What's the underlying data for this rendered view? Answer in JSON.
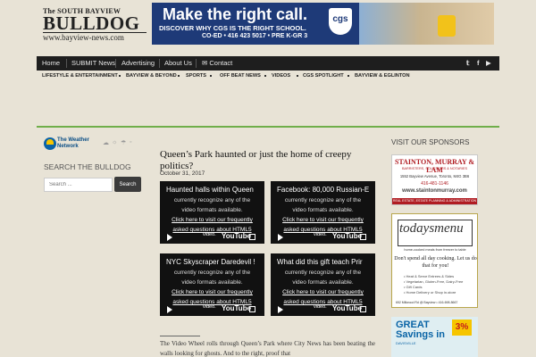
{
  "masthead": {
    "line1": "The SOUTH BAYVIEW",
    "line2": "BULLDOG",
    "line3": "www.bayview-news.com"
  },
  "banner": {
    "headline": "Make the right call.",
    "line1": "DISCOVER WHY CGS IS THE RIGHT SCHOOL.",
    "line2": "CO-ED • 416 423 5017 • PRE K-GR 3",
    "logo": "cgs"
  },
  "nav": {
    "items": [
      "Home",
      "SUBMIT News",
      "Advertising",
      "About Us",
      "Contact"
    ],
    "social_icons": [
      "twitter-icon",
      "facebook-icon",
      "youtube-icon"
    ]
  },
  "subnav": {
    "items": [
      "LIFESTYLE & ENTERTAINMENT",
      "BAYVIEW & BEYOND",
      "SPORTS",
      "OFF BEAT NEWS",
      "VIDEOS",
      "CGS SPOTLIGHT",
      "BAYVIEW & EGLINTON"
    ]
  },
  "sidebar": {
    "weather": {
      "line1": "The Weather",
      "line2": "Network"
    },
    "search_heading": "SEARCH THE BULLDOG",
    "search_placeholder": "Search ...",
    "search_button": "Search"
  },
  "article": {
    "title": "Queen’s Park haunted or just the home of creepy politics?",
    "date": "October 31, 2017",
    "body": "The Video Wheel rolls through Queen’s Park where City News has been beating the walls looking for ghosts. And to the right, proof that"
  },
  "videos": [
    {
      "title": "Haunted halls within Queen"
    },
    {
      "title": "Facebook: 80,000 Russian-E"
    },
    {
      "title": "NYC Skyscraper Daredevil !"
    },
    {
      "title": "What did this gift teach Prir"
    }
  ],
  "video_player": {
    "message1": "currently recognize any of the",
    "message2": "video formats available.",
    "link1": "Click here to visit our frequently",
    "link2": "asked questions about HTML5",
    "link3": "video.",
    "youtube": "YouTube"
  },
  "sponsors": {
    "heading": "VISIT OUR SPONSORS",
    "stainton": {
      "name": "STAINTON, MURRAY & LAM",
      "tag": "BARRISTERS, SOLICITORS & NOTARIES",
      "address": "1552 Bayview Avenue, Toronto, M4G 3B6",
      "phone": "416-481-1146",
      "url": "www.staintonmurray.com",
      "bar": "REAL ESTATE, ESTATE PLANNING & ADMINISTRATION"
    },
    "todaysmenu": {
      "logo": "todaysmenu",
      "sub": "home-cooked meals from freezer to table",
      "headline": "Don't spend all day cooking. Let us do that for you!",
      "items": [
        "• Heat & Serve Entrees & Sides",
        "• Vegetarian, Gluten-Free, Dairy-Free",
        "• Gift Cards",
        "• Home Delivery or Shop in-store"
      ],
      "address": "652 Millwood Rd @ Bayview  •  416-698-8667"
    },
    "davisville": {
      "line1": "GREAT",
      "line2": "Savings in",
      "line3": "DAVISVILLE",
      "percent": "3%"
    }
  }
}
